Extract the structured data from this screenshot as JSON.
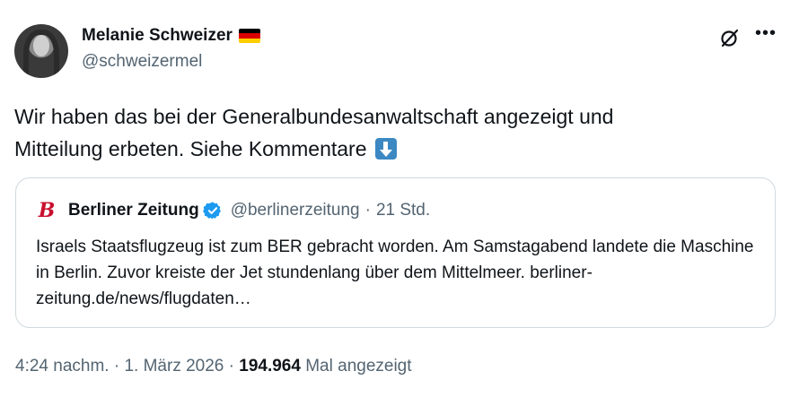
{
  "author": {
    "name": "Melanie Schweizer",
    "handle": "@schweizermel",
    "flag_colors": [
      "#000000",
      "#dd0000",
      "#ffce00"
    ]
  },
  "icons": {
    "grok": "grok-icon",
    "more": "more-icon",
    "down_arrow": "down-arrow-emoji-icon",
    "verified": "verified-badge-icon"
  },
  "tweet": {
    "text_line1": "Wir haben das bei der Generalbundesanwaltschaft angezeigt und",
    "text_line2": "Mitteilung erbeten. Siehe Kommentare"
  },
  "quote": {
    "logo_letter": "B",
    "name": "Berliner Zeitung",
    "handle": "@berlinerzeitung",
    "separator": "·",
    "time": "21 Std.",
    "text": "Israels Staatsflugzeug ist zum BER gebracht worden. Am Samstagabend landete die Maschine in Berlin. Zuvor kreiste der Jet stundenlang über dem Mittelmeer. berliner-zeitung.de/news/flugdaten…"
  },
  "footer": {
    "time": "4:24 nachm.",
    "date": "1. März 2026",
    "views_count": "194.964",
    "views_label": "Mal angezeigt"
  },
  "colors": {
    "accent_blue": "#1d9bf0",
    "muted": "#536471",
    "brand_red": "#c8102e"
  }
}
